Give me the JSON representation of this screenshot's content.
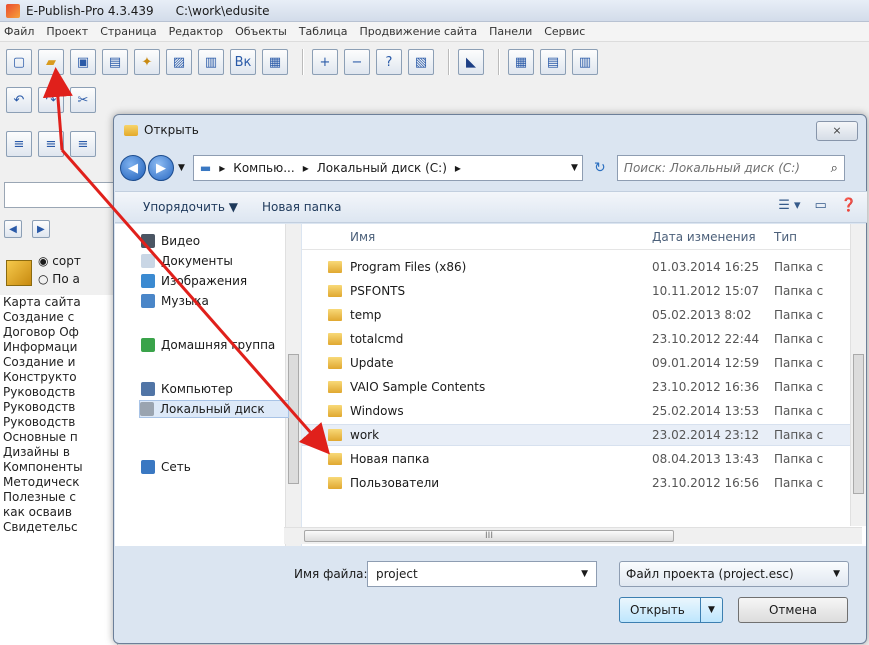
{
  "app": {
    "title": "E-Publish-Pro 4.3.439",
    "path": "C:\\work\\edusite",
    "menu": [
      "Файл",
      "Проект",
      "Страница",
      "Редактор",
      "Объекты",
      "Таблица",
      "Продвижение сайта",
      "Панели",
      "Сервис"
    ]
  },
  "left_panel": {
    "radio1": "сорт",
    "radio2": "По а",
    "items": [
      "Карта сайта",
      "Создание с",
      "Договор Оф",
      "Информаци",
      "Создание и",
      "Конструкто",
      "Руководств",
      "Руководств",
      "Руководств",
      "Основные п",
      "Дизайны в",
      "Компоненты",
      "Методическ",
      "Полезные с",
      "как осваив",
      "Свидетельс"
    ]
  },
  "dialog": {
    "title": "Открыть",
    "close_glyph": "⨯",
    "breadcrumb": [
      "Компью...",
      "Локальный диск (C:)"
    ],
    "search_placeholder": "Поиск: Локальный диск (C:)",
    "organize_label": "Упорядочить ▼",
    "new_folder_label": "Новая папка",
    "nav_items": [
      {
        "label": "Видео",
        "color": "#4a5563"
      },
      {
        "label": "Документы",
        "color": "#c9d6e5"
      },
      {
        "label": "Изображения",
        "color": "#3b8ad1"
      },
      {
        "label": "Музыка",
        "color": "#4a86c8"
      },
      {
        "label": "Домашняя группа",
        "color": "#3aa34a"
      },
      {
        "label": "Компьютер",
        "color": "#5175a6"
      },
      {
        "label": "Локальный диск",
        "color": "#9aa4b0"
      },
      {
        "label": "Сеть",
        "color": "#3a78c2"
      }
    ],
    "columns": {
      "name": "Имя",
      "date": "Дата изменения",
      "type": "Тип"
    },
    "files": [
      {
        "name": "Program Files (x86)",
        "date": "01.03.2014 16:25",
        "type": "Папка с"
      },
      {
        "name": "PSFONTS",
        "date": "10.11.2012 15:07",
        "type": "Папка с"
      },
      {
        "name": "temp",
        "date": "05.02.2013 8:02",
        "type": "Папка с"
      },
      {
        "name": "totalcmd",
        "date": "23.10.2012 22:44",
        "type": "Папка с"
      },
      {
        "name": "Update",
        "date": "09.01.2014 12:59",
        "type": "Папка с"
      },
      {
        "name": "VAIO Sample Contents",
        "date": "23.10.2012 16:36",
        "type": "Папка с"
      },
      {
        "name": "Windows",
        "date": "25.02.2014 13:53",
        "type": "Папка с"
      },
      {
        "name": "work",
        "date": "23.02.2014 23:12",
        "type": "Папка с"
      },
      {
        "name": "Новая папка",
        "date": "08.04.2013 13:43",
        "type": "Папка с"
      },
      {
        "name": "Пользователи",
        "date": "23.10.2012 16:56",
        "type": "Папка с"
      }
    ],
    "scroll_glyph": "III",
    "filename_label": "Имя файла:",
    "filename_value": "project",
    "filetype_value": "Файл проекта (project.esc)",
    "open_label": "Открыть",
    "cancel_label": "Отмена"
  }
}
